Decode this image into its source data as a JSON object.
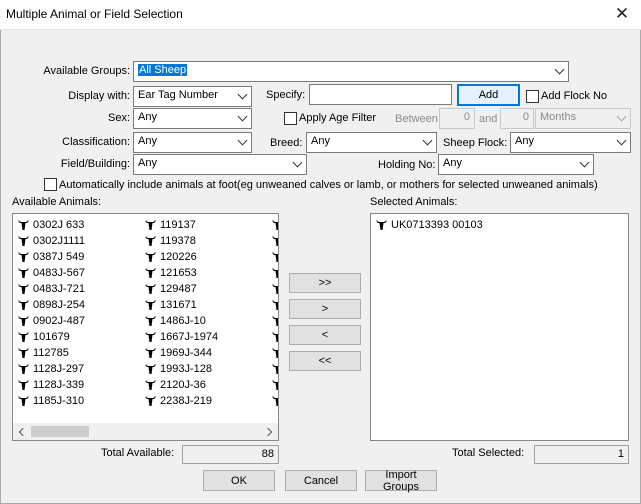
{
  "window": {
    "title": "Multiple Animal or Field Selection",
    "close_glyph": "✕"
  },
  "form": {
    "available_groups_label": "Available Groups:",
    "available_groups_value": "All Sheep",
    "display_with_label": "Display with:",
    "display_with_value": "Ear Tag Number",
    "specify_label": "Specify:",
    "specify_value": "",
    "add_label": "Add",
    "add_flock_no_label": "Add Flock No",
    "sex_label": "Sex:",
    "sex_value": "Any",
    "apply_age_filter_label": "Apply Age Filter",
    "between_label": "Between",
    "age_from": "0",
    "and_label": "and",
    "age_to": "0",
    "age_unit": "Months",
    "classification_label": "Classification:",
    "classification_value": "Any",
    "breed_label": "Breed:",
    "breed_value": "Any",
    "sheep_flock_label": "Sheep Flock:",
    "sheep_flock_value": "Any",
    "field_building_label": "Field/Building:",
    "field_building_value": "Any",
    "holding_no_label": "Holding No:",
    "holding_no_value": "Any",
    "auto_include_label": "Automatically include animals at foot(eg unweaned calves or lamb, or mothers for selected unweaned animals)"
  },
  "available": {
    "label": "Available Animals:",
    "col1": [
      "0302J 633",
      "0302J1111",
      "0387J 549",
      "0483J-567",
      "0483J-721",
      "0898J-254",
      "0902J-487",
      "101679",
      "112785",
      "1128J-297",
      "1128J-339",
      "1185J-310"
    ],
    "col2": [
      "119137",
      "119378",
      "120226",
      "121653",
      "129487",
      "131671",
      "1486J-10",
      "1667J-1974",
      "1969J-344",
      "1993J-128",
      "2120J-36",
      "2238J-219"
    ],
    "total_label": "Total Available:",
    "total_value": "88"
  },
  "move_buttons": {
    "add_all": ">>",
    "add": ">",
    "remove": "<",
    "remove_all": "<<"
  },
  "selected": {
    "label": "Selected Animals:",
    "items": [
      "UK0713393 00103"
    ],
    "total_label": "Total Selected:",
    "total_value": "1"
  },
  "footer": {
    "ok": "OK",
    "cancel": "Cancel",
    "import_groups": "Import Groups"
  },
  "icons": {
    "animal": "sheep-head-icon"
  },
  "colors": {
    "selection": "#0078d7",
    "focus_border": "#0078d7"
  }
}
